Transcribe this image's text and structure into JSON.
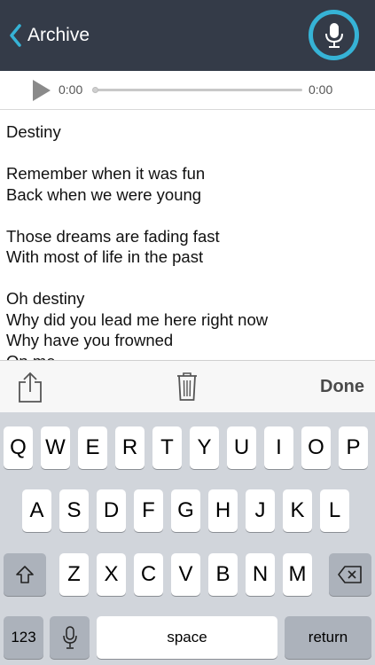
{
  "nav": {
    "back_label": "Archive",
    "accent": "#36b3d6",
    "background": "#343b48"
  },
  "player": {
    "current_time": "0:00",
    "total_time": "0:00",
    "progress": 0
  },
  "lyrics": [
    "Destiny",
    "",
    "Remember when it was fun",
    "Back when we were young",
    "",
    "Those dreams are fading fast",
    "With most of life in the past",
    "",
    "Oh destiny",
    "Why did you lead me here right now",
    "Why have you frowned",
    "On me"
  ],
  "toolbar": {
    "done_label": "Done"
  },
  "keyboard": {
    "row1": [
      "Q",
      "W",
      "E",
      "R",
      "T",
      "Y",
      "U",
      "I",
      "O",
      "P"
    ],
    "row2": [
      "A",
      "S",
      "D",
      "F",
      "G",
      "H",
      "J",
      "K",
      "L"
    ],
    "row3": [
      "Z",
      "X",
      "C",
      "V",
      "B",
      "N",
      "M"
    ],
    "numbers_label": "123",
    "space_label": "space",
    "return_label": "return"
  },
  "icons": {
    "back": "chevron-left-icon",
    "mic": "microphone-icon",
    "play": "play-icon",
    "share": "share-icon",
    "trash": "trash-icon",
    "shift": "shift-icon",
    "delete": "delete-icon",
    "dictation": "microphone-icon"
  }
}
